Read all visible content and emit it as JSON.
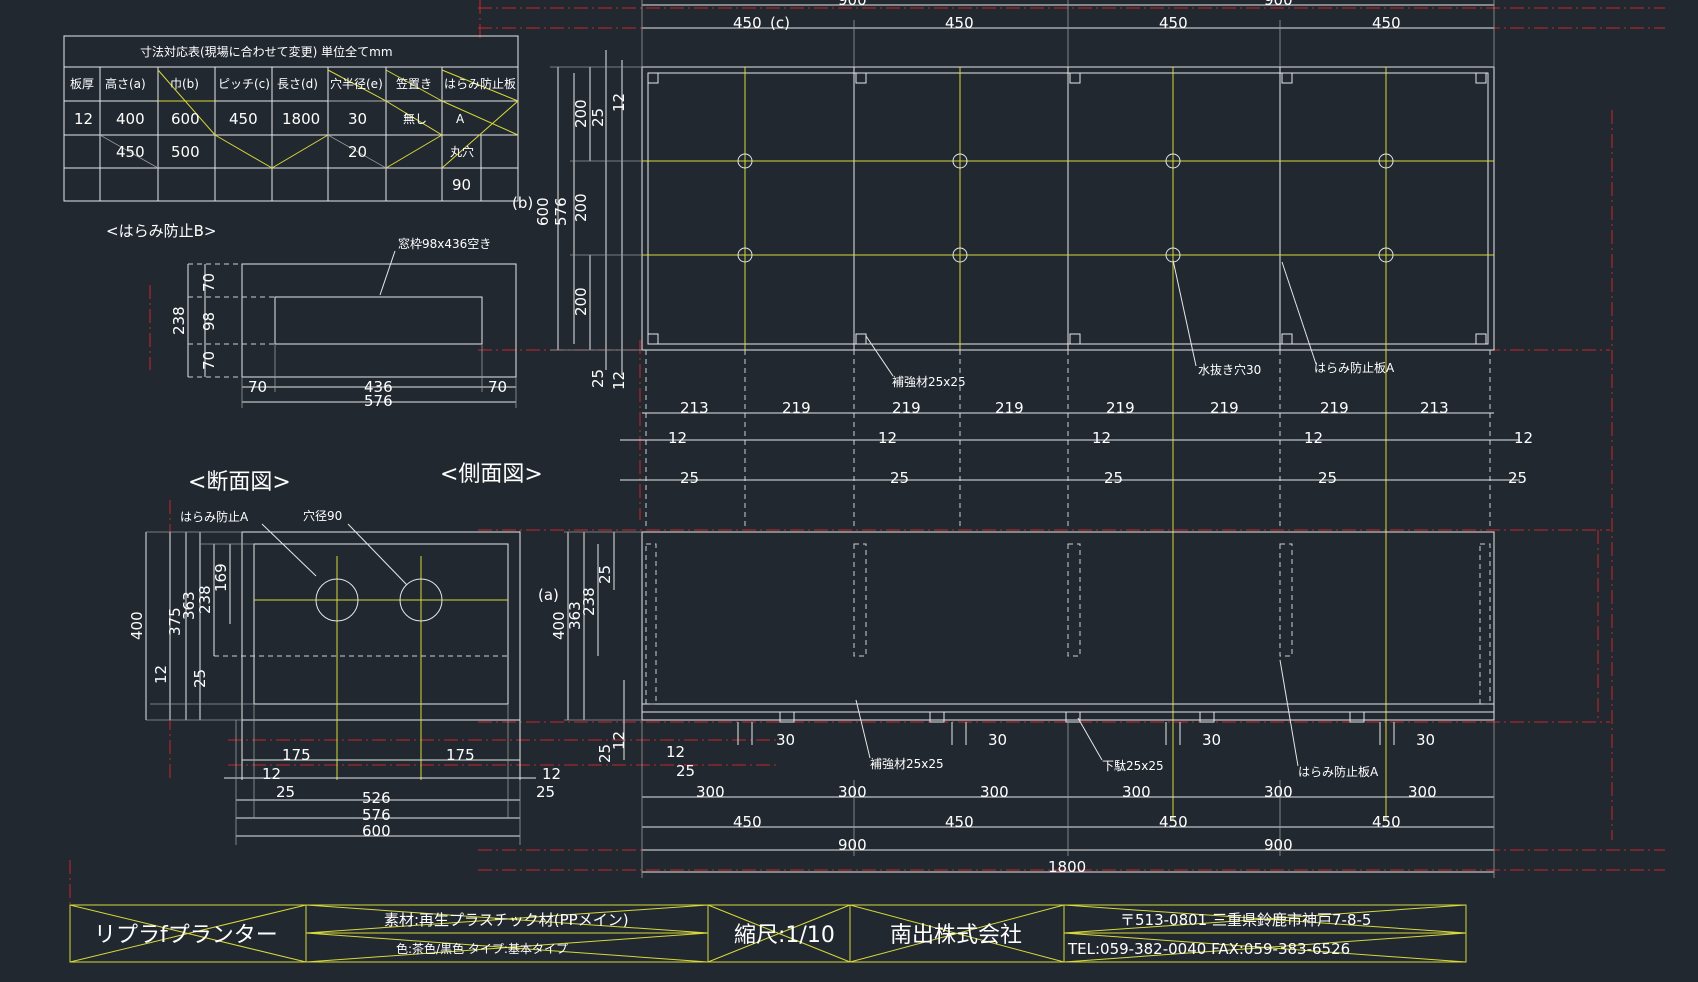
{
  "table": {
    "title": "寸法対応表(現場に合わせて変更) 単位全てmm",
    "headers": [
      "板厚",
      "高さ(a)",
      "巾(b)",
      "ピッチ(c)",
      "長さ(d)",
      "穴半径(e)",
      "笠置き",
      "はらみ防止板"
    ],
    "rows": [
      [
        "12",
        "400",
        "600",
        "450",
        "1800",
        "30",
        "無し",
        "A"
      ],
      [
        "",
        "450",
        "500",
        "",
        "",
        "20",
        "",
        "丸穴"
      ],
      [
        "",
        "",
        "",
        "",
        "",
        "",
        "",
        "90"
      ]
    ]
  },
  "labels": {
    "harami_b": "<はらみ防止B>",
    "window": "窓枠98x436空き",
    "dannen": "<断面図>",
    "sokumen": "<側面図>",
    "harami_a_left": "はらみ防止A",
    "hole90": "穴径90",
    "hokyou": "補強材25x25",
    "mizunuki": "水抜き穴30",
    "harami_a_plate": "はらみ防止板A",
    "geta": "下駄25x25",
    "mark_a": "(a)",
    "mark_b": "(b)",
    "mark_c": "(c)"
  },
  "dims": {
    "top_900": "900",
    "d450": "450",
    "d200": "200",
    "d25": "25",
    "d12": "12",
    "d576": "576",
    "d600": "600",
    "d213": "213",
    "d219": "219",
    "d30": "30",
    "d300": "300",
    "d1800": "1800",
    "d70": "70",
    "d98": "98",
    "d238": "238",
    "d436": "436",
    "d400": "400",
    "d375": "375",
    "d363": "363",
    "d169": "169",
    "d175": "175",
    "d526": "526"
  },
  "titleblock": {
    "product": "リプラfプランター",
    "material": "素材:再生プラスチック材(PPメイン)",
    "color_type": "色:茶色/黒色 タイプ:基本タイプ",
    "scale": "縮尺:1/10",
    "company": "南出株式会社",
    "address": "〒513-0801 三重県鈴鹿市神戸7-8-5",
    "tel": "TEL:059-382-0040 FAX:059-383-6526"
  }
}
